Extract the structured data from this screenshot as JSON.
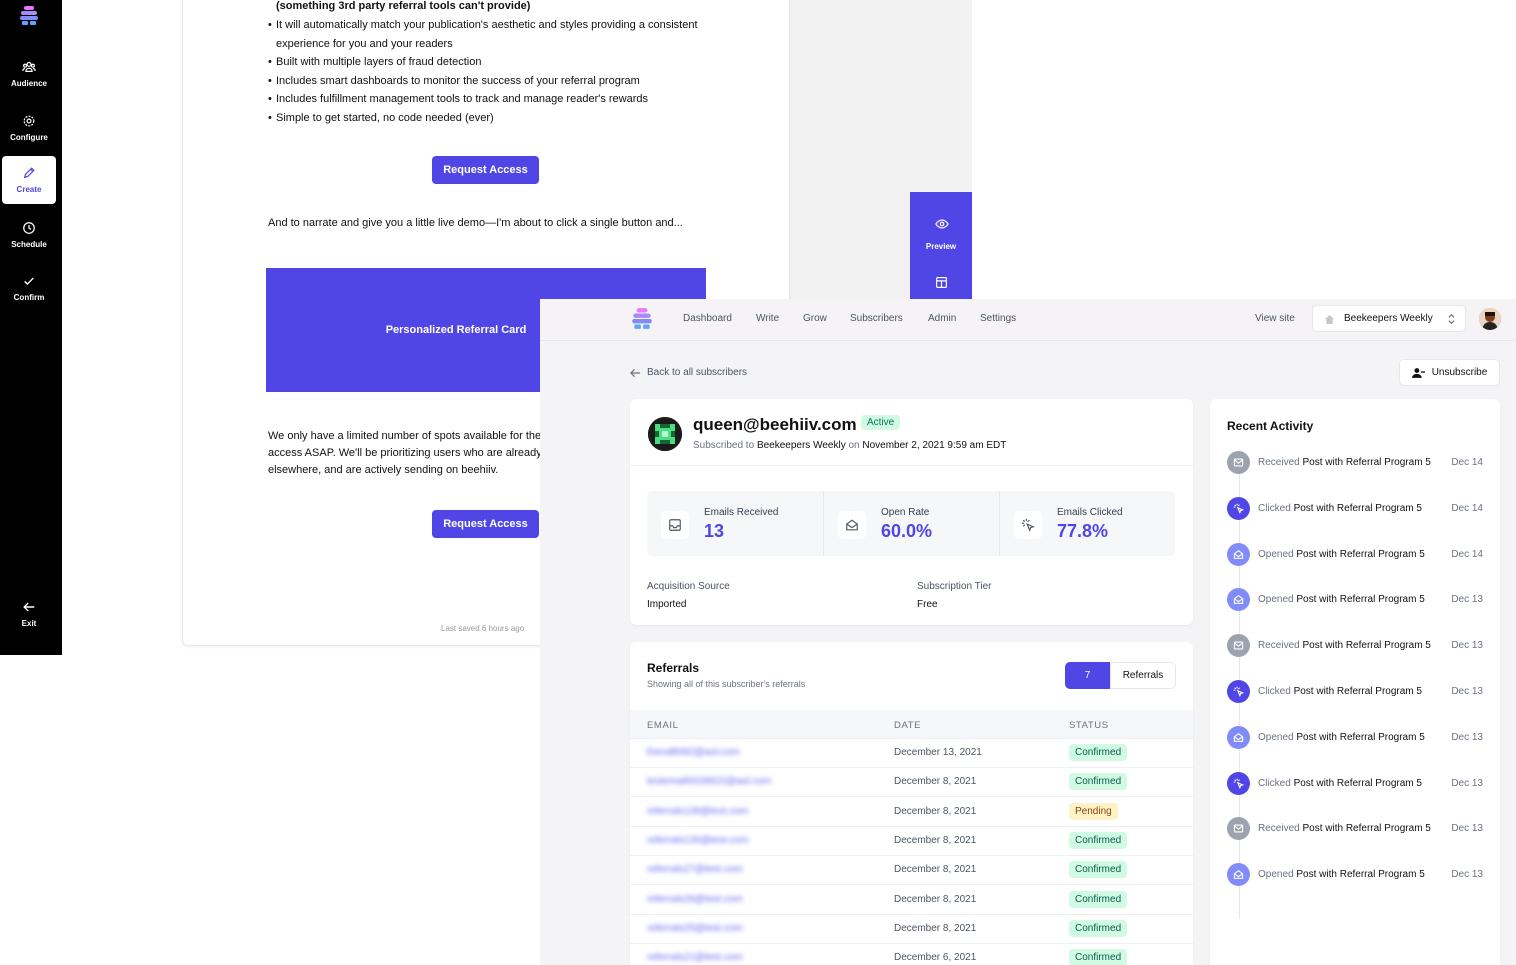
{
  "editor": {
    "sidebar": [
      {
        "label": "Audience",
        "icon": "audience-icon"
      },
      {
        "label": "Configure",
        "icon": "gear-icon"
      },
      {
        "label": "Create",
        "icon": "pencil-icon",
        "active": true
      },
      {
        "label": "Schedule",
        "icon": "clock-icon"
      },
      {
        "label": "Confirm",
        "icon": "check-icon"
      },
      {
        "label": "Exit",
        "icon": "arrow-left-icon"
      }
    ],
    "heading_fragment": "(something 3rd party referral tools can't provide)",
    "bullets": [
      "It will automatically match your publication's aesthetic and styles providing a consistent experience for you and your readers",
      "Built with multiple layers of fraud detection",
      "Includes smart dashboards to monitor the success of your referral program",
      "Includes fulfillment management tools to track and manage reader's rewards",
      "Simple to get started, no code needed (ever)"
    ],
    "request_button": "Request Access",
    "demo_text": "And to narrate and give you a little live demo—I'm about to click a single button and...",
    "referral_card_label": "Personalized Referral Card",
    "limited_text_lines": [
      "We only have a limited number of spots available for the",
      "access ASAP. We'll be prioritizing users who are already",
      "elsewhere, and are actively sending on beehiiv."
    ],
    "last_saved": "Last saved 6 hours ago",
    "preview_label": "Preview"
  },
  "app": {
    "nav": [
      "Dashboard",
      "Write",
      "Grow",
      "Subscribers",
      "Admin",
      "Settings"
    ],
    "view_site": "View site",
    "publication": "Beekeepers Weekly",
    "back_link": "Back to all subscribers",
    "unsubscribe": "Unsubscribe",
    "subscriber": {
      "email": "queen@beehiiv.com",
      "status": "Active",
      "subscribed_prefix": "Subscribed to",
      "publication": "Beekeepers Weekly",
      "on": "on",
      "date": "November 2, 2021 9:59 am EDT"
    },
    "stats": [
      {
        "label": "Emails Received",
        "value": "13",
        "icon": "inbox-icon"
      },
      {
        "label": "Open Rate",
        "value": "60.0%",
        "icon": "envelope-open-icon"
      },
      {
        "label": "Emails Clicked",
        "value": "77.8%",
        "icon": "cursor-click-icon"
      }
    ],
    "acquisition": {
      "label": "Acquisition Source",
      "value": "Imported"
    },
    "tier": {
      "label": "Subscription Tier",
      "value": "Free"
    },
    "referrals": {
      "title": "Referrals",
      "subtitle": "Showing all of this subscriber's referrals",
      "count": "7",
      "count_label": "Referrals",
      "columns": [
        "EMAIL",
        "DATE",
        "STATUS"
      ],
      "rows": [
        {
          "email": "friend8092@aol.com",
          "date": "December 13, 2021",
          "status": "Confirmed"
        },
        {
          "email": "testemail0028922@aol.com",
          "date": "December 8, 2021",
          "status": "Confirmed"
        },
        {
          "email": "referrals128@test.com",
          "date": "December 8, 2021",
          "status": "Pending"
        },
        {
          "email": "referrals126@test.com",
          "date": "December 8, 2021",
          "status": "Confirmed"
        },
        {
          "email": "referrals27@test.com",
          "date": "December 8, 2021",
          "status": "Confirmed"
        },
        {
          "email": "referrals26@test.com",
          "date": "December 8, 2021",
          "status": "Confirmed"
        },
        {
          "email": "referrals25@test.com",
          "date": "December 8, 2021",
          "status": "Confirmed"
        },
        {
          "email": "referrals21@test.com",
          "date": "December 6, 2021",
          "status": "Confirmed"
        }
      ]
    },
    "activity": {
      "title": "Recent Activity",
      "items": [
        {
          "action": "Received",
          "post": "Post with Referral Program 5",
          "date": "Dec 14",
          "kind": "received"
        },
        {
          "action": "Clicked",
          "post": "Post with Referral Program 5",
          "date": "Dec 14",
          "kind": "clicked"
        },
        {
          "action": "Opened",
          "post": "Post with Referral Program 5",
          "date": "Dec 14",
          "kind": "opened"
        },
        {
          "action": "Opened",
          "post": "Post with Referral Program 5",
          "date": "Dec 13",
          "kind": "opened"
        },
        {
          "action": "Received",
          "post": "Post with Referral Program 5",
          "date": "Dec 13",
          "kind": "received"
        },
        {
          "action": "Clicked",
          "post": "Post with Referral Program 5",
          "date": "Dec 13",
          "kind": "clicked"
        },
        {
          "action": "Opened",
          "post": "Post with Referral Program 5",
          "date": "Dec 13",
          "kind": "opened"
        },
        {
          "action": "Clicked",
          "post": "Post with Referral Program 5",
          "date": "Dec 13",
          "kind": "clicked"
        },
        {
          "action": "Received",
          "post": "Post with Referral Program 5",
          "date": "Dec 13",
          "kind": "received"
        },
        {
          "action": "Opened",
          "post": "Post with Referral Program 5",
          "date": "Dec 13",
          "kind": "opened"
        }
      ]
    },
    "colors": {
      "accent": "#4f46e5",
      "received": "#9ca3af",
      "clicked": "#4f46e5",
      "opened": "#818cf8"
    }
  }
}
